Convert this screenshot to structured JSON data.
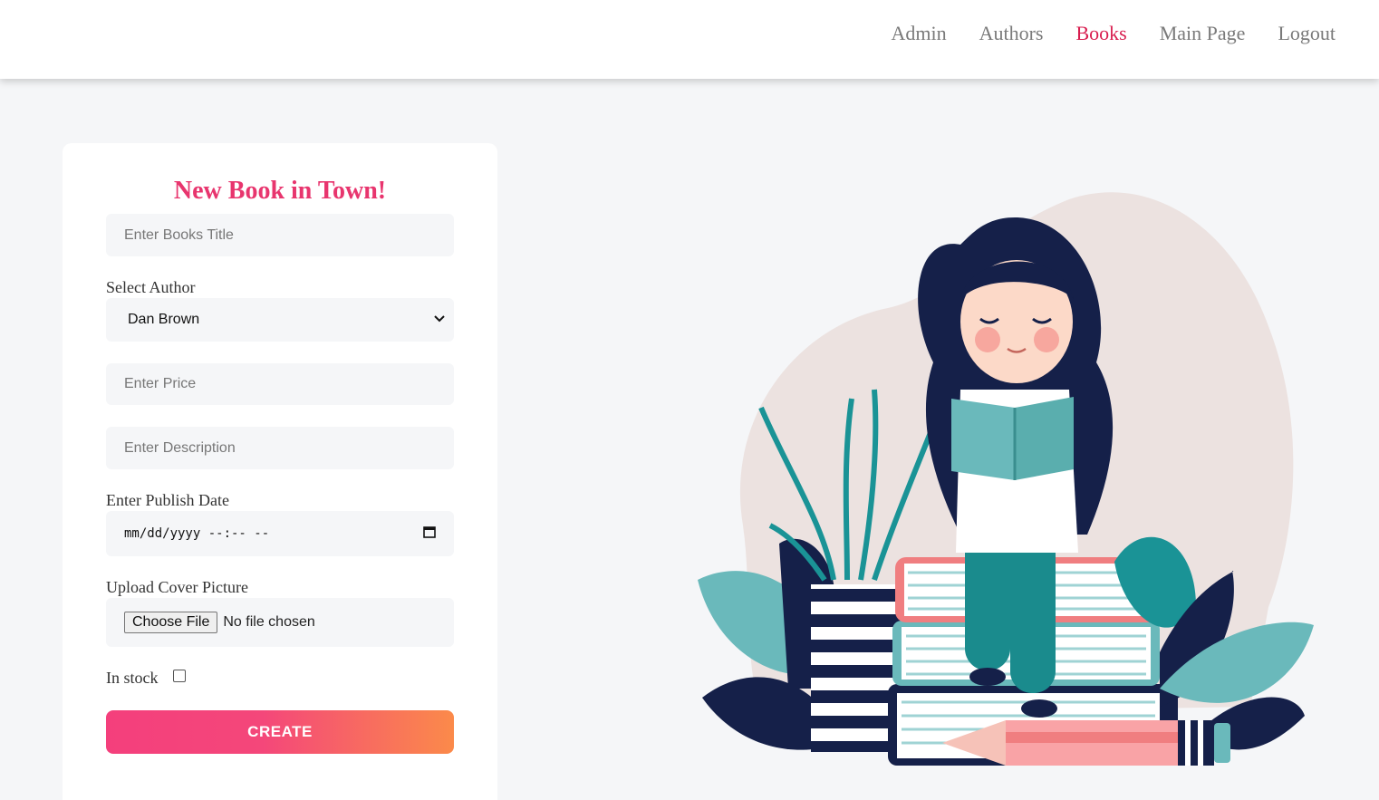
{
  "nav": {
    "items": [
      {
        "label": "Admin",
        "active": false
      },
      {
        "label": "Authors",
        "active": false
      },
      {
        "label": "Books",
        "active": true
      },
      {
        "label": "Main Page",
        "active": false
      },
      {
        "label": "Logout",
        "active": false
      }
    ],
    "active_color": "#d81e4f"
  },
  "form": {
    "title": "New Book in Town!",
    "title_placeholder": "Enter Books Title",
    "author_label": "Select Author",
    "author_selected": "Dan Brown",
    "price_placeholder": "Enter Price",
    "description_placeholder": "Enter Description",
    "date_label": "Enter Publish Date",
    "date_value": "mm/dd/yyyy --:-- --",
    "cover_label": "Upload Cover Picture",
    "file_button": "Choose File",
    "file_status": "No file chosen",
    "stock_label": "In stock",
    "in_stock": false,
    "create_label": "CREATE"
  },
  "colors": {
    "accent": "#e8356e",
    "button_gradient_start": "#f43f7c",
    "button_gradient_end": "#fb8a4a"
  },
  "illustration": {
    "icon": "girl-reading-on-books-illustration"
  }
}
